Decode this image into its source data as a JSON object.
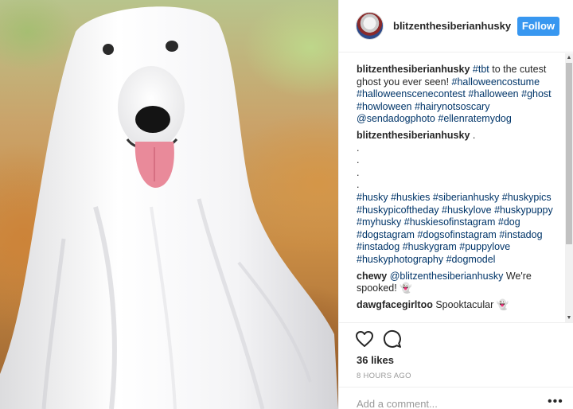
{
  "post": {
    "username": "blitzenthesiberianhusky",
    "follow_label": "Follow",
    "likes": "36 likes",
    "timestamp": "8 HOURS AGO",
    "comment_placeholder": "Add a comment...",
    "more_label": "•••"
  },
  "caption": {
    "user": "blitzenthesiberianhusky",
    "parts": [
      "#tbt",
      " to the cutest ghost you ever seen! ",
      "#halloweencostume",
      " ",
      "#halloweenscenecontest",
      " ",
      "#halloween",
      " ",
      "#ghost",
      " ",
      "#howloween",
      " ",
      "#hairynotsoscary",
      " ",
      "@sendadogphoto",
      " ",
      "#ellenratemydog"
    ]
  },
  "hashtag_comment": {
    "user": "blitzenthesiberianhusky",
    "first_dot": ".",
    "dots": [
      ".",
      ".",
      ".",
      "."
    ],
    "tags": [
      "#husky",
      "#huskies",
      "#siberianhusky",
      "#huskypics",
      "#huskypicoftheday",
      "#huskylove",
      "#huskypuppy",
      "#myhusky",
      "#huskiesofinstagram",
      "#dog",
      "#dogstagram",
      "#dogsofinstagram",
      "#instadog",
      "#instadog",
      "#huskygram",
      "#puppylove",
      "#huskyphotography",
      "#dogmodel"
    ]
  },
  "comments": [
    {
      "user": "chewy",
      "mention": "@blitzenthesiberianhusky",
      "text": " We're spooked! 👻"
    },
    {
      "user": "dawgfacegirltoo",
      "mention": "",
      "text": " Spooktacular 👻"
    }
  ],
  "icons": [
    "heart-icon",
    "comment-icon",
    "ghost-emoji-icon"
  ],
  "colors": {
    "follow_bg": "#3897f0",
    "link": "#003569",
    "muted": "#999999",
    "text": "#262626"
  }
}
